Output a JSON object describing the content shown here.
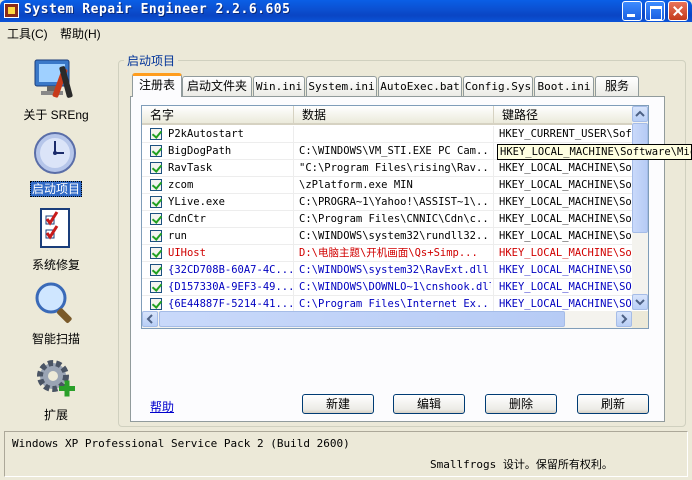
{
  "window": {
    "title": "System Repair Engineer 2.2.6.605"
  },
  "menu": {
    "tools": "工具(C)",
    "help": "帮助(H)"
  },
  "nav": [
    {
      "label": "关于 SREng",
      "icon": "tools-icon"
    },
    {
      "label": "启动项目",
      "icon": "clock-icon",
      "selected": true
    },
    {
      "label": "系统修复",
      "icon": "checklist-icon"
    },
    {
      "label": "智能扫描",
      "icon": "magnifier-icon"
    },
    {
      "label": "扩展",
      "icon": "gear-plus-icon"
    }
  ],
  "group_title": "启动项目",
  "tabs": [
    "注册表",
    "启动文件夹",
    "Win.ini",
    "System.ini",
    "AutoExec.bat",
    "Config.Sys",
    "Boot.ini",
    "服务"
  ],
  "active_tab": "注册表",
  "list": {
    "columns": [
      "名字",
      "数据",
      "键路径"
    ],
    "rows": [
      {
        "checked": true,
        "name": "P2kAutostart",
        "data": "",
        "key": "HKEY_CURRENT_USER\\Soft",
        "color": "black"
      },
      {
        "checked": true,
        "name": "BigDogPath",
        "data": "C:\\WINDOWS\\VM_STI.EXE PC Cam...",
        "key": "HKEY_LOCAL_MACHINE\\Sof",
        "color": "black"
      },
      {
        "checked": true,
        "name": "RavTask",
        "data": "\"C:\\Program Files\\rising\\Rav...",
        "key": "HKEY_LOCAL_MACHINE\\Sof",
        "color": "black"
      },
      {
        "checked": true,
        "name": "zcom",
        "data": "\\zPlatform.exe MIN",
        "key": "HKEY_LOCAL_MACHINE\\Sof",
        "color": "black"
      },
      {
        "checked": true,
        "name": "YLive.exe",
        "data": "C:\\PROGRA~1\\Yahoo!\\ASSIST~1\\...",
        "key": "HKEY_LOCAL_MACHINE\\Sof",
        "color": "black"
      },
      {
        "checked": true,
        "name": "CdnCtr",
        "data": "C:\\Program Files\\CNNIC\\Cdn\\c...",
        "key": "HKEY_LOCAL_MACHINE\\Sof",
        "color": "black"
      },
      {
        "checked": true,
        "name": "run",
        "data": "C:\\WINDOWS\\system32\\rundll32...",
        "key": "HKEY_LOCAL_MACHINE\\Sof",
        "color": "black"
      },
      {
        "checked": true,
        "name": "UIHost",
        "data": "D:\\电脑主题\\开机画面\\Qs+Simp...",
        "key": "HKEY_LOCAL_MACHINE\\Sof",
        "color": "red"
      },
      {
        "checked": true,
        "name": "{32CD708B-60A7-4C...",
        "data": "C:\\WINDOWS\\system32\\RavExt.dll",
        "key": "HKEY_LOCAL_MACHINE\\SOF",
        "color": "blue"
      },
      {
        "checked": true,
        "name": "{D157330A-9EF3-49...",
        "data": "C:\\WINDOWS\\DOWNLO~1\\cnshook.dll",
        "key": "HKEY_LOCAL_MACHINE\\SOF",
        "color": "blue"
      },
      {
        "checked": true,
        "name": "{6E44887F-5214-41...",
        "data": "C:\\Program Files\\Internet Ex...",
        "key": "HKEY_LOCAL_MACHINE\\SOF",
        "color": "blue"
      }
    ]
  },
  "tooltip": "HKEY_LOCAL_MACHINE\\Software\\Micr",
  "buttons": {
    "help": "帮助",
    "new": "新建",
    "edit": "编辑",
    "delete": "删除",
    "refresh": "刷新"
  },
  "status": {
    "os": "Windows XP Professional Service Pack 2 (Build 2600)",
    "copyright": "Smallfrogs 设计。保留所有权利。"
  },
  "colors": {
    "title_bar": "#0a5fe6",
    "selection": "#316ac5",
    "red_row": "#d00000",
    "blue_row": "#0000c0",
    "tab_accent": "#ff9d1d"
  }
}
